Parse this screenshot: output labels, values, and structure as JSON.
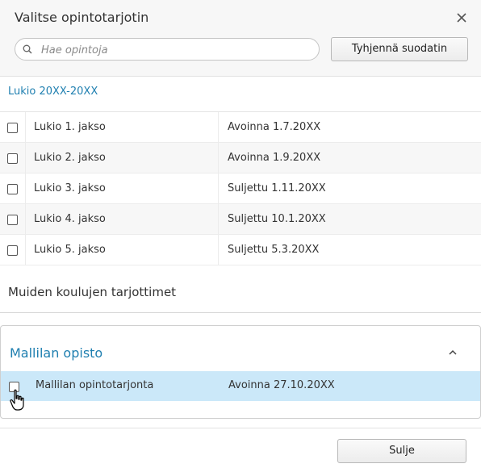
{
  "dialog": {
    "title": "Valitse opintotarjotin",
    "close_icon": "close-icon"
  },
  "search": {
    "placeholder": "Hae opintoja",
    "value": "",
    "icon": "search-icon"
  },
  "clear_filter_label": "Tyhjennä suodatin",
  "group": {
    "title": "Lukio 20XX-20XX",
    "rows": [
      {
        "name": "Lukio 1. jakso",
        "status": "Avoinna 1.7.20XX",
        "checked": false
      },
      {
        "name": "Lukio 2. jakso",
        "status": "Avoinna 1.9.20XX",
        "checked": false
      },
      {
        "name": "Lukio 3. jakso",
        "status": "Suljettu 1.11.20XX",
        "checked": false
      },
      {
        "name": "Lukio 4. jakso",
        "status": "Suljettu 10.1.20XX",
        "checked": false
      },
      {
        "name": "Lukio 5. jakso",
        "status": "Suljettu 5.3.20XX",
        "checked": false
      }
    ]
  },
  "other_schools": {
    "heading": "Muiden koulujen tarjottimet",
    "panel": {
      "title": "Mallilan opisto",
      "toggle_icon": "chevron-up-icon",
      "row": {
        "name": "Mallilan opintotarjonta",
        "status": "Avoinna 27.10.20XX",
        "checked": false
      }
    }
  },
  "footer": {
    "close_label": "Sulje"
  },
  "colors": {
    "link": "#1f7fb0",
    "highlight": "#cbe8f9"
  }
}
